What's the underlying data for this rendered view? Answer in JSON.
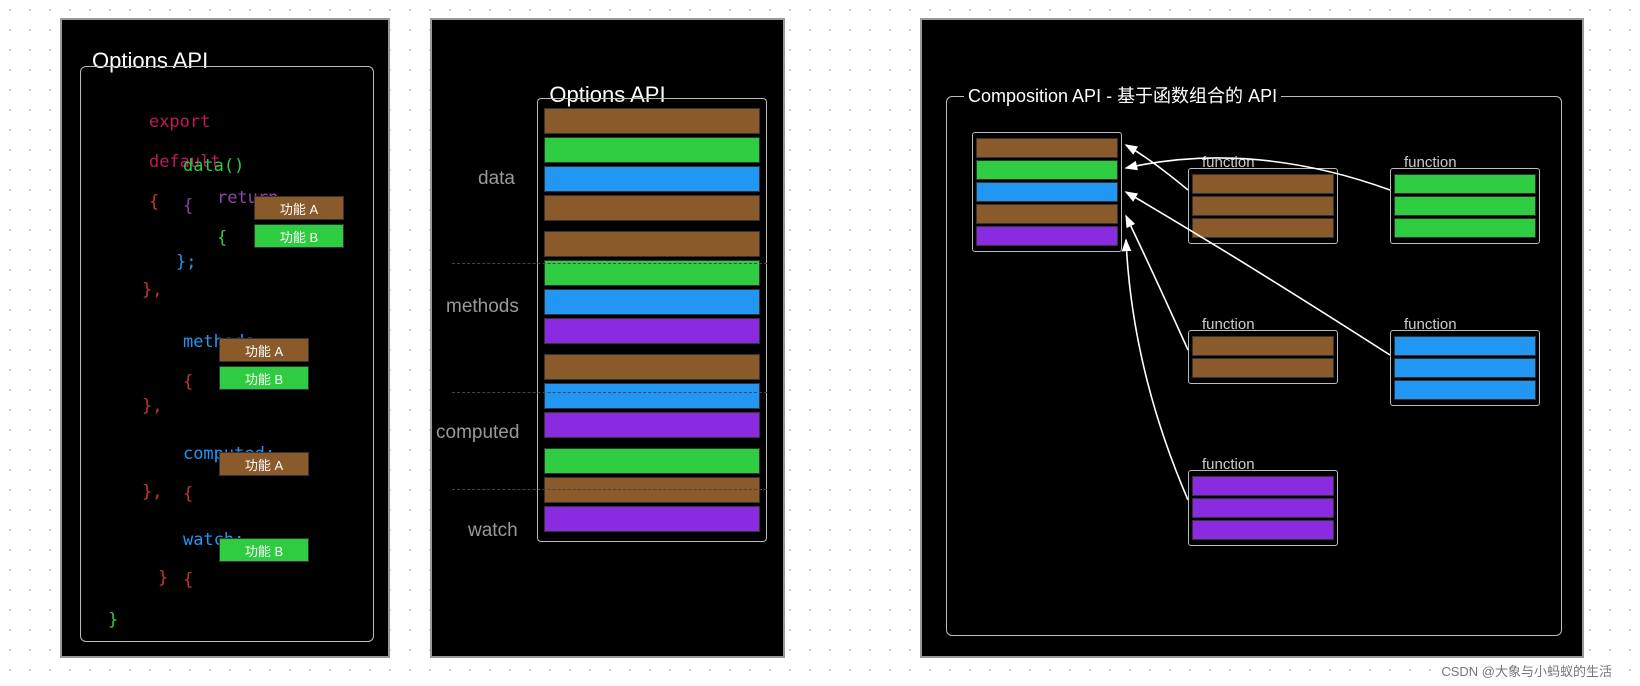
{
  "watermark": "CSDN @大象与小蚂蚁的生活",
  "panel1": {
    "title": "Options API",
    "code": {
      "export": "export",
      "default": "default",
      "brace_open": "{",
      "data_fn": "data()",
      "return": "return",
      "brace": "{",
      "brace_close_semi": "};",
      "comma_brace": "},",
      "methods": "methods:",
      "computed": "computed:",
      "watch": "watch:",
      "close_brace": "}"
    },
    "chips": {
      "featureA": "功能 A",
      "featureB": "功能 B"
    }
  },
  "panel2": {
    "title": "Options API",
    "labels": {
      "data": "data",
      "methods": "methods",
      "computed": "computed",
      "watch": "watch"
    },
    "sections": [
      {
        "name": "data",
        "bars": [
          "brown",
          "green",
          "blue",
          "brown"
        ]
      },
      {
        "name": "methods",
        "bars": [
          "brown",
          "green",
          "blue",
          "purple"
        ]
      },
      {
        "name": "computed",
        "bars": [
          "brown",
          "blue",
          "purple"
        ]
      },
      {
        "name": "watch",
        "bars": [
          "green",
          "brown",
          "purple"
        ]
      }
    ]
  },
  "panel3": {
    "title": "Composition API - 基于函数组合的 API",
    "function_label": "function",
    "result_bars": [
      "brown",
      "green",
      "blue",
      "brown",
      "purple"
    ],
    "groups": [
      {
        "color": "brown",
        "count": 3
      },
      {
        "color": "green",
        "count": 3
      },
      {
        "color": "brown",
        "count": 2
      },
      {
        "color": "blue",
        "count": 3
      },
      {
        "color": "purple",
        "count": 3
      }
    ]
  }
}
